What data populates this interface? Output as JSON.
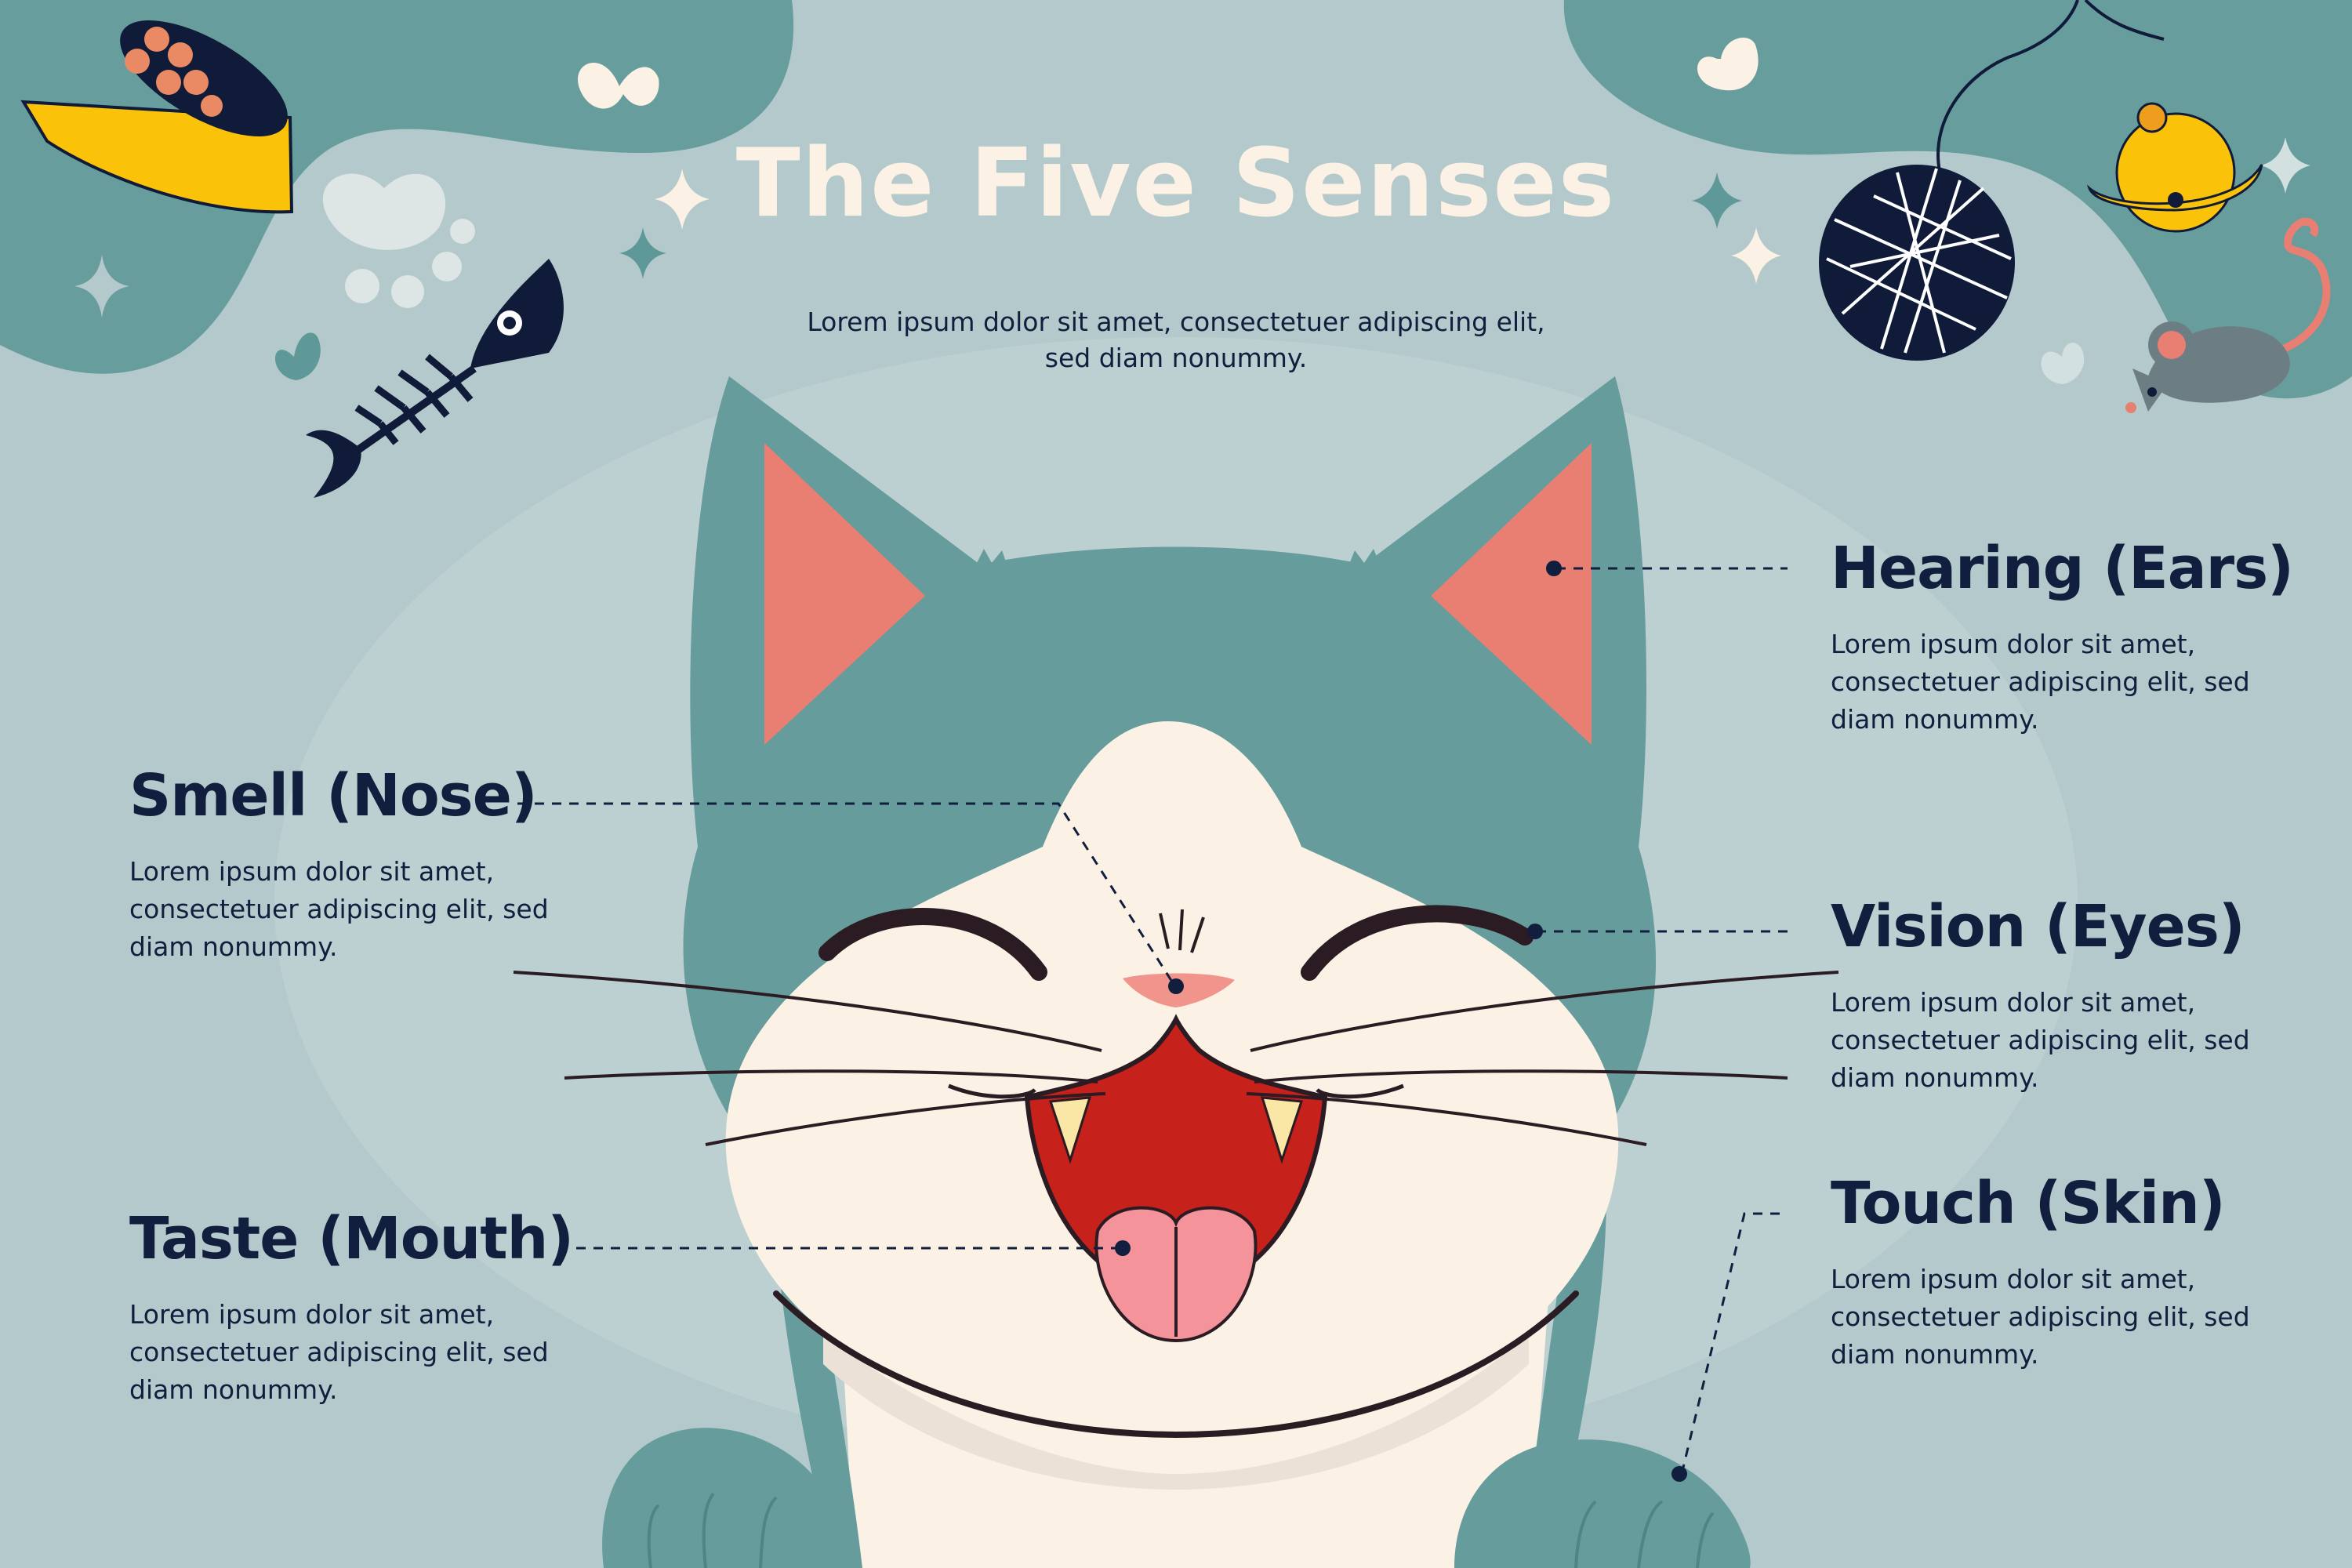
{
  "title": "The Five Senses",
  "subtitle": "Lorem ipsum dolor sit amet, consectetuer adipiscing elit, sed diam nonummy.",
  "senses": [
    {
      "label": "Smell (Nose)",
      "body": "Lorem ipsum dolor sit amet, consectetuer adipiscing elit, sed diam nonummy."
    },
    {
      "label": "Taste (Mouth)",
      "body": "Lorem ipsum dolor sit amet, consectetuer adipiscing elit, sed diam nonummy."
    },
    {
      "label": "Hearing (Ears)",
      "body": "Lorem ipsum dolor sit amet, consectetuer adipiscing elit, sed diam nonummy."
    },
    {
      "label": "Vision (Eyes)",
      "body": "Lorem ipsum dolor sit amet, consectetuer adipiscing elit, sed diam nonummy."
    },
    {
      "label": "Touch (Skin)",
      "body": "Lorem ipsum dolor sit amet, consectetuer adipiscing elit, sed diam nonummy."
    }
  ],
  "colors": {
    "background": "#b4c9cb",
    "blob": "#679d9d",
    "cat_fur": "#669c9c",
    "cat_face": "#fcf1e5",
    "ear_inner": "#e87f72",
    "mouth": "#c7211b",
    "tongue": "#f4939a",
    "text": "#111e3d",
    "title": "#fbf1e4"
  },
  "icons": [
    "food-bowl-icon",
    "paw-print-icon",
    "fish-bone-icon",
    "heart-icon",
    "sparkle-icon",
    "yarn-ball-icon",
    "bell-toy-icon",
    "toy-mouse-icon"
  ]
}
